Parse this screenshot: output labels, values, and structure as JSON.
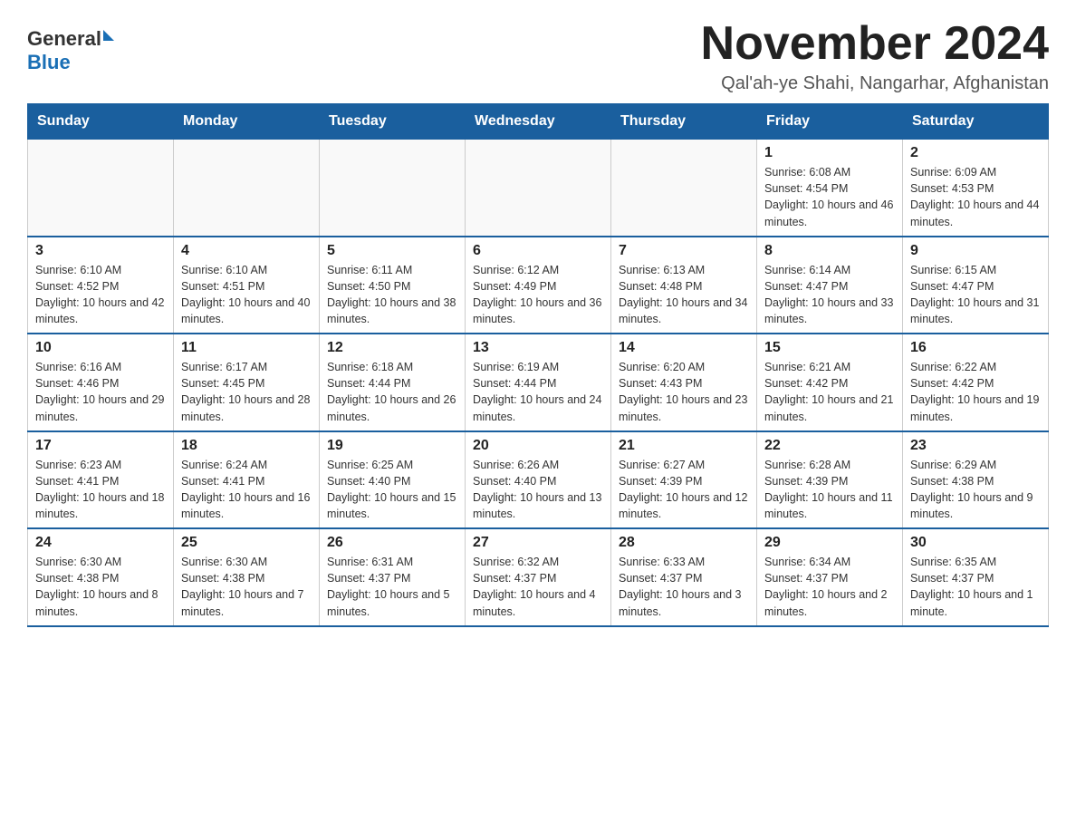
{
  "logo": {
    "general": "General",
    "blue": "Blue"
  },
  "title": "November 2024",
  "location": "Qal'ah-ye Shahi, Nangarhar, Afghanistan",
  "days_of_week": [
    "Sunday",
    "Monday",
    "Tuesday",
    "Wednesday",
    "Thursday",
    "Friday",
    "Saturday"
  ],
  "weeks": [
    [
      {
        "day": "",
        "info": ""
      },
      {
        "day": "",
        "info": ""
      },
      {
        "day": "",
        "info": ""
      },
      {
        "day": "",
        "info": ""
      },
      {
        "day": "",
        "info": ""
      },
      {
        "day": "1",
        "info": "Sunrise: 6:08 AM\nSunset: 4:54 PM\nDaylight: 10 hours and 46 minutes."
      },
      {
        "day": "2",
        "info": "Sunrise: 6:09 AM\nSunset: 4:53 PM\nDaylight: 10 hours and 44 minutes."
      }
    ],
    [
      {
        "day": "3",
        "info": "Sunrise: 6:10 AM\nSunset: 4:52 PM\nDaylight: 10 hours and 42 minutes."
      },
      {
        "day": "4",
        "info": "Sunrise: 6:10 AM\nSunset: 4:51 PM\nDaylight: 10 hours and 40 minutes."
      },
      {
        "day": "5",
        "info": "Sunrise: 6:11 AM\nSunset: 4:50 PM\nDaylight: 10 hours and 38 minutes."
      },
      {
        "day": "6",
        "info": "Sunrise: 6:12 AM\nSunset: 4:49 PM\nDaylight: 10 hours and 36 minutes."
      },
      {
        "day": "7",
        "info": "Sunrise: 6:13 AM\nSunset: 4:48 PM\nDaylight: 10 hours and 34 minutes."
      },
      {
        "day": "8",
        "info": "Sunrise: 6:14 AM\nSunset: 4:47 PM\nDaylight: 10 hours and 33 minutes."
      },
      {
        "day": "9",
        "info": "Sunrise: 6:15 AM\nSunset: 4:47 PM\nDaylight: 10 hours and 31 minutes."
      }
    ],
    [
      {
        "day": "10",
        "info": "Sunrise: 6:16 AM\nSunset: 4:46 PM\nDaylight: 10 hours and 29 minutes."
      },
      {
        "day": "11",
        "info": "Sunrise: 6:17 AM\nSunset: 4:45 PM\nDaylight: 10 hours and 28 minutes."
      },
      {
        "day": "12",
        "info": "Sunrise: 6:18 AM\nSunset: 4:44 PM\nDaylight: 10 hours and 26 minutes."
      },
      {
        "day": "13",
        "info": "Sunrise: 6:19 AM\nSunset: 4:44 PM\nDaylight: 10 hours and 24 minutes."
      },
      {
        "day": "14",
        "info": "Sunrise: 6:20 AM\nSunset: 4:43 PM\nDaylight: 10 hours and 23 minutes."
      },
      {
        "day": "15",
        "info": "Sunrise: 6:21 AM\nSunset: 4:42 PM\nDaylight: 10 hours and 21 minutes."
      },
      {
        "day": "16",
        "info": "Sunrise: 6:22 AM\nSunset: 4:42 PM\nDaylight: 10 hours and 19 minutes."
      }
    ],
    [
      {
        "day": "17",
        "info": "Sunrise: 6:23 AM\nSunset: 4:41 PM\nDaylight: 10 hours and 18 minutes."
      },
      {
        "day": "18",
        "info": "Sunrise: 6:24 AM\nSunset: 4:41 PM\nDaylight: 10 hours and 16 minutes."
      },
      {
        "day": "19",
        "info": "Sunrise: 6:25 AM\nSunset: 4:40 PM\nDaylight: 10 hours and 15 minutes."
      },
      {
        "day": "20",
        "info": "Sunrise: 6:26 AM\nSunset: 4:40 PM\nDaylight: 10 hours and 13 minutes."
      },
      {
        "day": "21",
        "info": "Sunrise: 6:27 AM\nSunset: 4:39 PM\nDaylight: 10 hours and 12 minutes."
      },
      {
        "day": "22",
        "info": "Sunrise: 6:28 AM\nSunset: 4:39 PM\nDaylight: 10 hours and 11 minutes."
      },
      {
        "day": "23",
        "info": "Sunrise: 6:29 AM\nSunset: 4:38 PM\nDaylight: 10 hours and 9 minutes."
      }
    ],
    [
      {
        "day": "24",
        "info": "Sunrise: 6:30 AM\nSunset: 4:38 PM\nDaylight: 10 hours and 8 minutes."
      },
      {
        "day": "25",
        "info": "Sunrise: 6:30 AM\nSunset: 4:38 PM\nDaylight: 10 hours and 7 minutes."
      },
      {
        "day": "26",
        "info": "Sunrise: 6:31 AM\nSunset: 4:37 PM\nDaylight: 10 hours and 5 minutes."
      },
      {
        "day": "27",
        "info": "Sunrise: 6:32 AM\nSunset: 4:37 PM\nDaylight: 10 hours and 4 minutes."
      },
      {
        "day": "28",
        "info": "Sunrise: 6:33 AM\nSunset: 4:37 PM\nDaylight: 10 hours and 3 minutes."
      },
      {
        "day": "29",
        "info": "Sunrise: 6:34 AM\nSunset: 4:37 PM\nDaylight: 10 hours and 2 minutes."
      },
      {
        "day": "30",
        "info": "Sunrise: 6:35 AM\nSunset: 4:37 PM\nDaylight: 10 hours and 1 minute."
      }
    ]
  ]
}
